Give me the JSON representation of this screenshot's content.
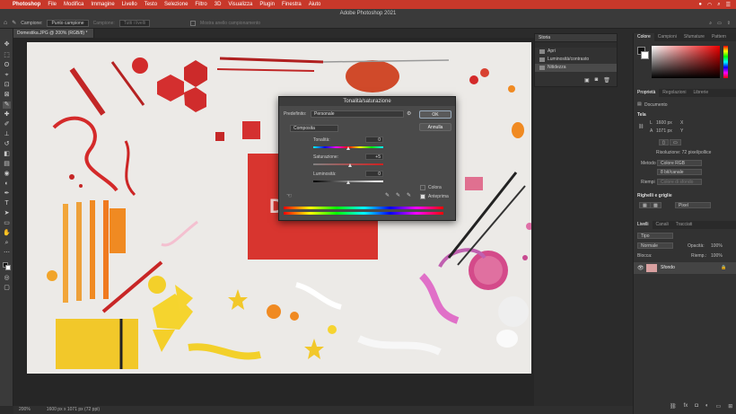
{
  "menubar": {
    "app": "Photoshop",
    "items": [
      "File",
      "Modifica",
      "Immagine",
      "Livello",
      "Testo",
      "Selezione",
      "Filtro",
      "3D",
      "Visualizza",
      "Plugin",
      "Finestra",
      "Aiuto"
    ]
  },
  "window": {
    "title": "Adobe Photoshop 2021"
  },
  "options": {
    "campione_label": "Campione:",
    "campione_value": "Punto campione",
    "tolleranza_label": "Campione:",
    "tolleranza_value": "Tutti i livelli",
    "mostra_label": "Mostra anello campionamento"
  },
  "document": {
    "tab": "Domestika.JPG @ 200% (RGB/8) *",
    "zoom": "200%",
    "size": "1600 px x 1071 px (72 ppi)"
  },
  "history": {
    "tab": "Storia",
    "items": [
      {
        "label": "Apri"
      },
      {
        "label": "Luminosità/contrasto"
      },
      {
        "label": "Nitidezza"
      }
    ]
  },
  "colorpanel": {
    "tabs": [
      "Colore",
      "Campioni",
      "Sfumature",
      "Pattern"
    ]
  },
  "properties": {
    "tabs": [
      "Proprietà",
      "Regolazioni",
      "Librerie"
    ],
    "doc_label": "Documento",
    "tela_label": "Tela",
    "L_label": "L",
    "L_value": "1600 px",
    "A_label": "A",
    "A_value": "1071 px",
    "X_label": "X",
    "Y_label": "Y",
    "risoluzione": "Risoluzione: 72 pixel/pollice",
    "metodo_label": "Metodo",
    "metodo_value": "Colore RGB",
    "bit_value": "8 bit/canale",
    "riempi_label": "Riempi",
    "riempi_value": "Colore di sfondo",
    "righelli_label": "Righelli e griglie",
    "pixel_value": "Pixel"
  },
  "layers": {
    "tabs": [
      "Livelli",
      "Canali",
      "Tracciati"
    ],
    "search": "Tipo",
    "blend": "Normale",
    "opacity_label": "Opacità:",
    "opacity_value": "100%",
    "blocca_label": "Blocca:",
    "riemp_label": "Riemp.:",
    "riemp_value": "100%",
    "items": [
      {
        "label": "Sfondo"
      }
    ]
  },
  "dialog": {
    "title": "Tonalità/saturazione",
    "preset_label": "Predefinito:",
    "preset_value": "Personale",
    "ok": "OK",
    "cancel": "Annulla",
    "channel": "Composita",
    "hue_label": "Tonalità:",
    "hue_value": "0",
    "hue_level": 0.5,
    "sat_label": "Saturazione:",
    "sat_value": "+5",
    "sat_level": 0.525,
    "light_label": "Luminosità:",
    "light_value": "0",
    "light_level": 0.5,
    "colorize_label": "Colora",
    "preview_label": "Anteprima"
  }
}
